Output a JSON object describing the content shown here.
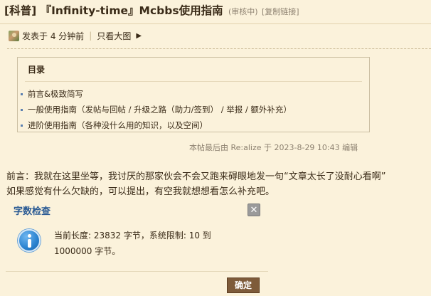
{
  "thread": {
    "title_main": "[科普] 『Infinity-time』Mcbbs使用指南",
    "status": "(审核中)",
    "copy_link": "[复制链接]"
  },
  "post_meta": {
    "posted": "发表于 4 分钟前",
    "separator": "|",
    "only_view_big": "只看大图"
  },
  "toc": {
    "heading": "目录",
    "items": [
      "前言&极致简写",
      "一般使用指南（发帖与回帖 / 升级之路（助力/签到） / 举报 / 额外补充）",
      "进阶使用指南（各种没什么用的知识，以及空间）"
    ]
  },
  "edit_note": "本帖最后由 Re:alize 于 2023-8-29 10:43 编辑",
  "post_body": {
    "line1": "前言：我就在这里坐等，我讨厌的那家伙会不会又跑来碍眼地发一句“文章太长了没耐心看啊”",
    "line2": "如果感觉有什么欠缺的，可以提出，有空我就想想看怎么补充吧。"
  },
  "dialog": {
    "title": "字数检查",
    "close_symbol": "✕",
    "message_line1": "当前长度: 23832 字节，系统限制: 10 到",
    "message_line2": "1000000 字节。",
    "ok_label": "确定"
  }
}
